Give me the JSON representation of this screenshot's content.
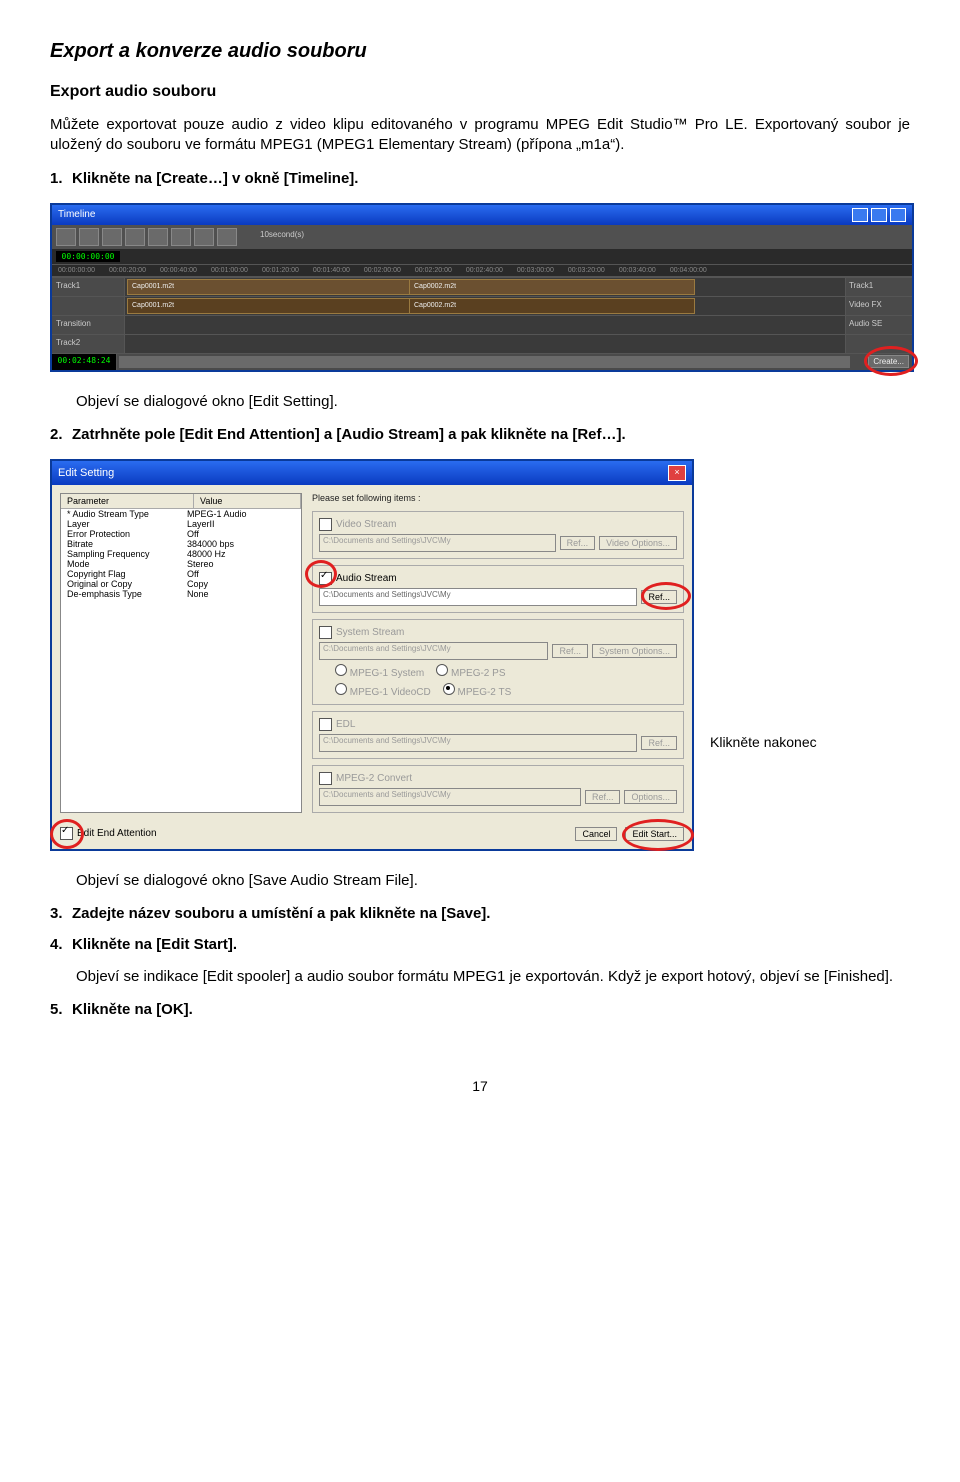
{
  "title": "Export a konverze audio souboru",
  "subtitle": "Export audio souboru",
  "intro": "Můžete exportovat pouze audio z video klipu editovaného v programu MPEG Edit Studio™ Pro LE. Exportovaný soubor je uložený do souboru ve formátu MPEG1 (MPEG1 Elementary Stream) (přípona „m1a“).",
  "steps": {
    "s1": "Klikněte na [Create…] v okně [Timeline].",
    "s1_after": "Objeví se dialogové okno [Edit Setting].",
    "s2": "Zatrhněte pole [Edit End Attention] a [Audio Stream] a pak klikněte na [Ref…].",
    "s2_caption": "Klikněte nakonec",
    "s2_after": "Objeví se dialogové okno [Save Audio Stream File].",
    "s3": "Zadejte název souboru a umístění a pak klikněte na [Save].",
    "s4": "Klikněte na [Edit Start].",
    "s4_after": "Objeví se indikace [Edit spooler] a audio soubor formátu MPEG1 je exportován. Když je export hotový, objeví se [Finished].",
    "s5": "Klikněte na [OK]."
  },
  "timeline": {
    "title": "Timeline",
    "zoom": "10second(s)",
    "tc_start": "00:00:00:00",
    "ruler": [
      "00:00:00:00",
      "00:00:20:00",
      "00:00:40:00",
      "00:01:00:00",
      "00:01:20:00",
      "00:01:40:00",
      "00:02:00:00",
      "00:02:20:00",
      "00:02:40:00",
      "00:03:00:00",
      "00:03:20:00",
      "00:03:40:00",
      "00:04:00:00"
    ],
    "track1": "Track1",
    "transition": "Transition",
    "track2": "Track2",
    "right_track1": "Track1",
    "right_video": "Video  FX",
    "right_audio": "Audio  SE",
    "clip1": "Cap0001.m2t",
    "clip2": "Cap0002.m2t",
    "clip1b": "Cap0001.m2t",
    "clip2b": "Cap0002.m2t",
    "tc_end": "00:02:48:24",
    "create": "Create..."
  },
  "dialog": {
    "title": "Edit Setting",
    "intro": "Please set following items :",
    "col_param": "Parameter",
    "col_value": "Value",
    "params": [
      {
        "p": "* Audio Stream Type",
        "v": "MPEG-1 Audio"
      },
      {
        "p": "Layer",
        "v": "LayerII"
      },
      {
        "p": "Error Protection",
        "v": "Off"
      },
      {
        "p": "Bitrate",
        "v": "384000 bps"
      },
      {
        "p": "Sampling Frequency",
        "v": "48000 Hz"
      },
      {
        "p": "Mode",
        "v": "Stereo"
      },
      {
        "p": "Copyright Flag",
        "v": "Off"
      },
      {
        "p": "Original or Copy",
        "v": "Copy"
      },
      {
        "p": "De-emphasis Type",
        "v": "None"
      }
    ],
    "grp_video": "Video Stream",
    "path_video": "C:\\Documents and Settings\\JVC\\My",
    "btn_ref": "Ref...",
    "btn_video_options": "Video Options...",
    "grp_audio": "Audio Stream",
    "path_audio": "C:\\Documents and Settings\\JVC\\My",
    "grp_system": "System Stream",
    "path_system": "C:\\Documents and Settings\\JVC\\My",
    "btn_system_options": "System Options...",
    "radio_mpeg1": "MPEG-1 System",
    "radio_mpeg2ps": "MPEG-2 PS",
    "radio_mpeg1vcd": "MPEG-1 VideoCD",
    "radio_mpeg2ts": "MPEG-2 TS",
    "grp_edl": "EDL",
    "path_edl": "C:\\Documents and Settings\\JVC\\My",
    "grp_mpeg2conv": "MPEG-2 Convert",
    "path_mpeg2conv": "C:\\Documents and Settings\\JVC\\My",
    "btn_options": "Options...",
    "chk_attention": "Edit End Attention",
    "btn_cancel": "Cancel",
    "btn_editstart": "Edit Start..."
  },
  "page_number": "17"
}
